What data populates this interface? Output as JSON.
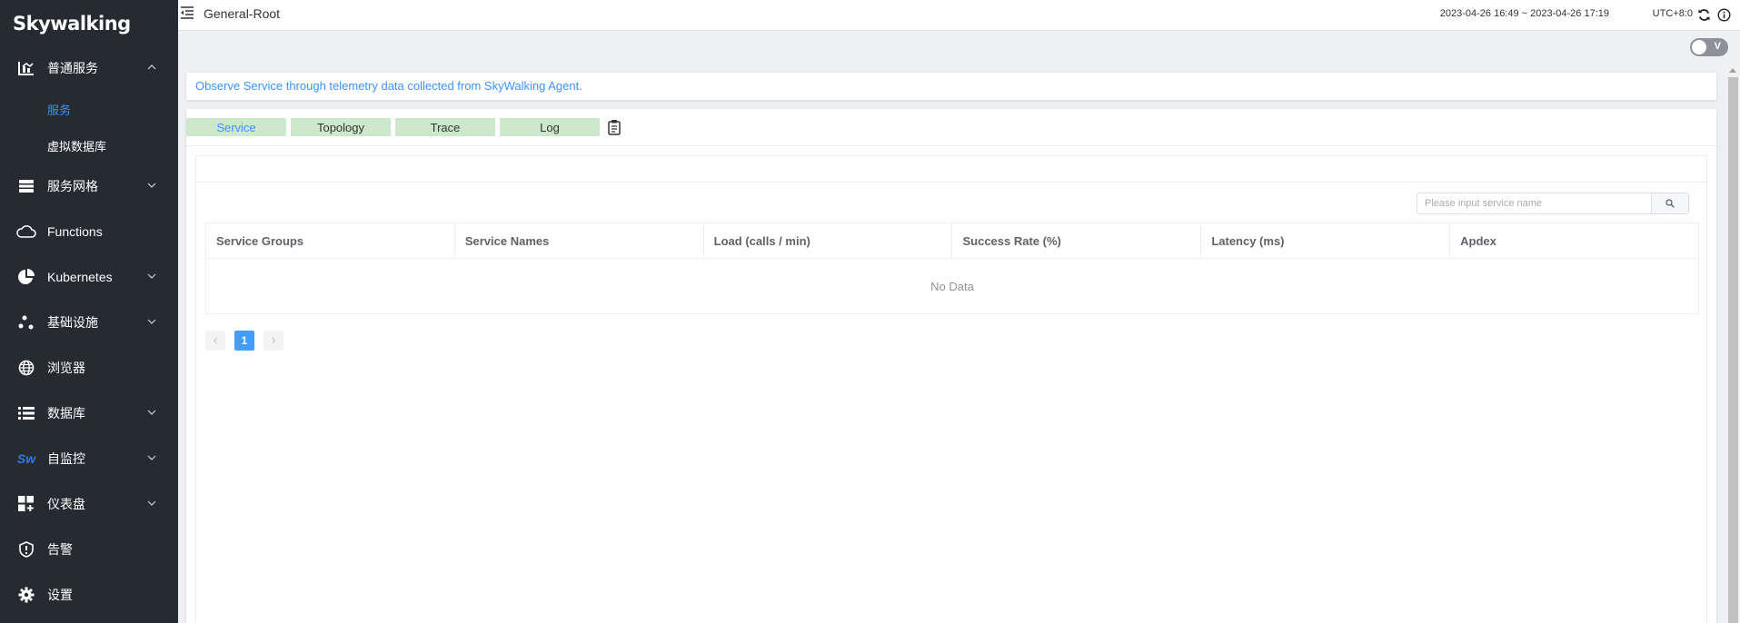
{
  "app": {
    "logo_text": "Skywalking"
  },
  "sidebar": {
    "items": [
      {
        "label": "普通服务",
        "icon": "bar-chart-icon",
        "expanded": true,
        "children": [
          {
            "label": "服务",
            "active": true
          },
          {
            "label": "虚拟数据库",
            "active": false
          }
        ]
      },
      {
        "label": "服务网格",
        "icon": "layers-icon",
        "expanded": false
      },
      {
        "label": "Functions",
        "icon": "cloud-icon",
        "expanded": false
      },
      {
        "label": "Kubernetes",
        "icon": "pie-chart-icon",
        "expanded": false
      },
      {
        "label": "基础设施",
        "icon": "nodes-icon",
        "expanded": false
      },
      {
        "label": "浏览器",
        "icon": "globe-icon",
        "expanded": false
      },
      {
        "label": "数据库",
        "icon": "list-icon",
        "expanded": false
      },
      {
        "label": "自监控",
        "icon": "sw-logo-icon",
        "icon_text": "Sw",
        "expanded": false
      },
      {
        "label": "仪表盘",
        "icon": "dashboard-grid-icon",
        "expanded": false
      },
      {
        "label": "告警",
        "icon": "alert-shield-icon",
        "expanded": false
      },
      {
        "label": "设置",
        "icon": "gear-icon",
        "expanded": false
      }
    ]
  },
  "header": {
    "title": "General-Root",
    "time_range": "2023-04-26 16:49 ~ 2023-04-26 17:19",
    "timezone": "UTC+8:0"
  },
  "toggle": {
    "label": "V",
    "on": false
  },
  "banner": {
    "text": "Observe Service through telemetry data collected from SkyWalking Agent."
  },
  "tabs": [
    {
      "label": "Service",
      "active": true
    },
    {
      "label": "Topology",
      "active": false
    },
    {
      "label": "Trace",
      "active": false
    },
    {
      "label": "Log",
      "active": false
    }
  ],
  "search": {
    "placeholder": "Please input service name",
    "value": ""
  },
  "table": {
    "columns": [
      "Service Groups",
      "Service Names",
      "Load (calls / min)",
      "Success Rate (%)",
      "Latency (ms)",
      "Apdex"
    ],
    "empty_text": "No Data"
  },
  "pagination": {
    "current_page": "1"
  },
  "colors": {
    "sidebar_bg": "#262a31",
    "accent": "#3d92ff",
    "tab_bg": "#cde8cd",
    "page_button": "#409eff"
  }
}
